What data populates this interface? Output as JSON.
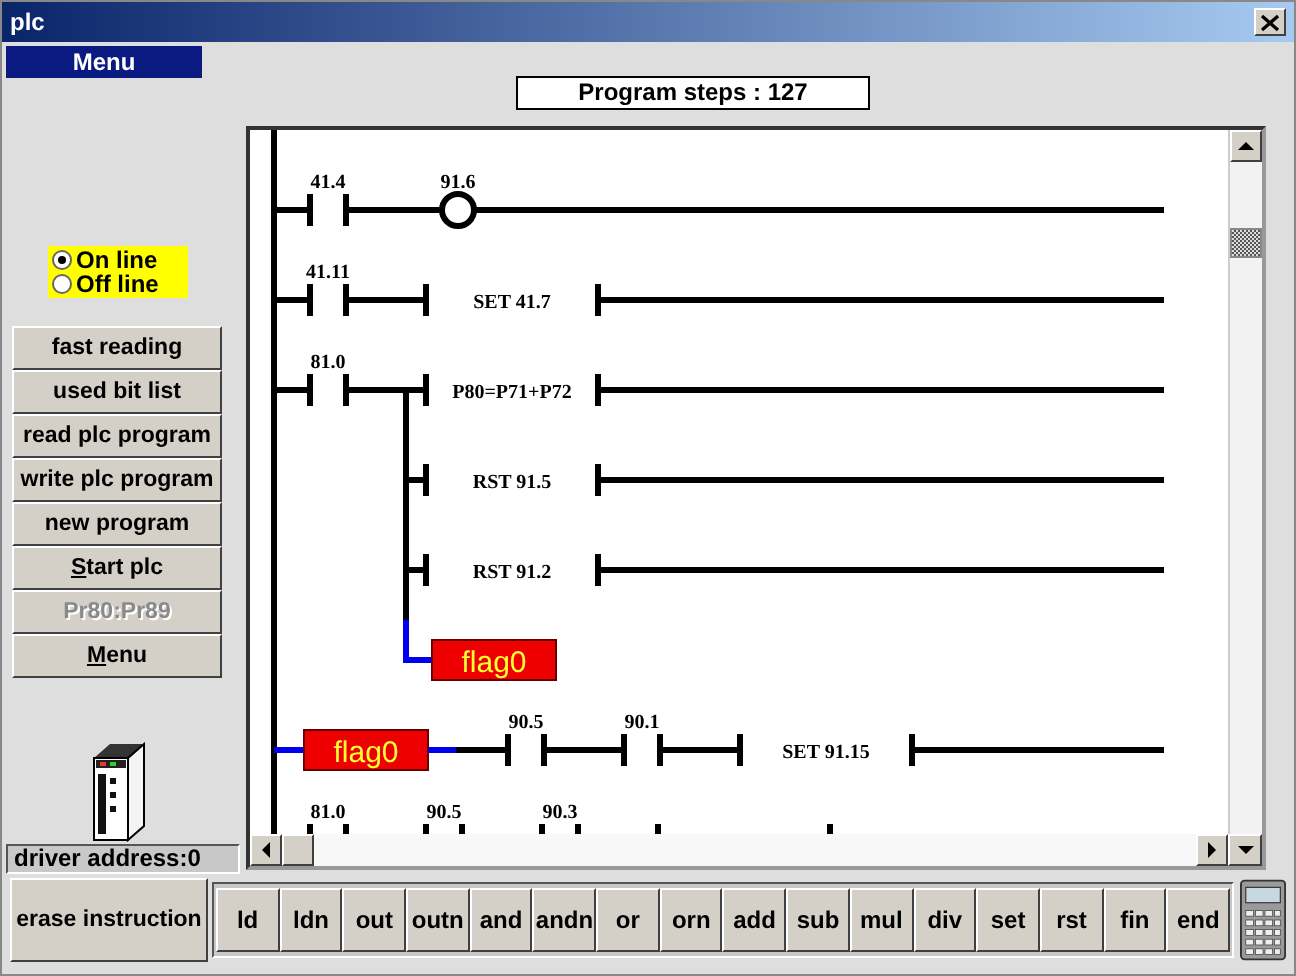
{
  "window": {
    "title": "plc"
  },
  "menu_header": "Menu",
  "program_steps": "Program steps : 127",
  "mode": [
    {
      "label": "On line",
      "selected": true
    },
    {
      "label": "Off line",
      "selected": false
    }
  ],
  "side_buttons": [
    {
      "label": "fast reading",
      "disabled": false,
      "accel": false
    },
    {
      "label": "used bit list",
      "disabled": false,
      "accel": false
    },
    {
      "label": "read plc program",
      "disabled": false,
      "accel": false
    },
    {
      "label": "write plc program",
      "disabled": false,
      "accel": false
    },
    {
      "label": "new program",
      "disabled": false,
      "accel": false
    },
    {
      "label": "Start plc",
      "disabled": false,
      "accel": true
    },
    {
      "label": "Pr80:Pr89",
      "disabled": true,
      "accel": false
    },
    {
      "label": "Menu",
      "disabled": false,
      "accel": true
    }
  ],
  "driver_address": "driver address:0",
  "ladder": {
    "rungs": [
      {
        "elements": [
          {
            "kind": "contact",
            "label": "41.4"
          },
          {
            "kind": "coil",
            "label": "91.6"
          }
        ]
      },
      {
        "elements": [
          {
            "kind": "contact",
            "label": "41.11"
          },
          {
            "kind": "box",
            "label": "SET 41.7"
          }
        ]
      },
      {
        "elements": [
          {
            "kind": "contact",
            "label": "81.0"
          },
          {
            "kind": "box",
            "label": "P80=P71+P72"
          }
        ],
        "branches": [
          {
            "kind": "box",
            "label": "RST 91.5"
          },
          {
            "kind": "box",
            "label": "RST 91.2"
          }
        ],
        "flag": "flag0"
      },
      {
        "elements": [
          {
            "kind": "flag",
            "label": "flag0"
          },
          {
            "kind": "contact",
            "label": "90.5"
          },
          {
            "kind": "contact",
            "label": "90.1"
          },
          {
            "kind": "box",
            "label": "SET 91.15"
          }
        ]
      },
      {
        "elements": [
          {
            "kind": "contact",
            "label": "81.0"
          },
          {
            "kind": "contact",
            "label": "90.5"
          },
          {
            "kind": "contact",
            "label": "90.3"
          },
          {
            "kind": "box"
          }
        ]
      }
    ]
  },
  "erase_button": "erase instruction",
  "instructions": [
    "ld",
    "ldn",
    "out",
    "outn",
    "and",
    "andn",
    "or",
    "orn",
    "add",
    "sub",
    "mul",
    "div",
    "set",
    "rst",
    "fin",
    "end"
  ]
}
